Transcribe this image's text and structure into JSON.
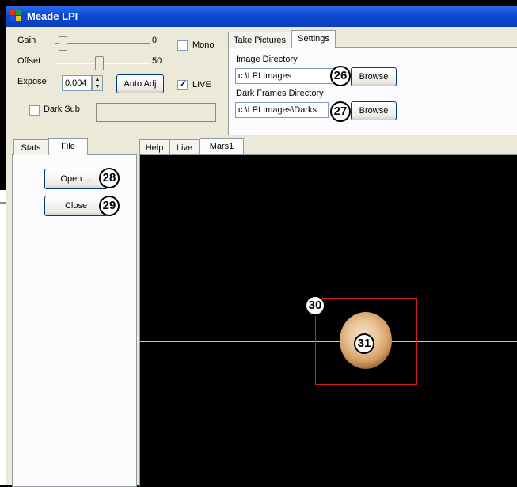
{
  "window": {
    "title": "Meade LPI"
  },
  "controls": {
    "gain": {
      "label": "Gain",
      "value": "0",
      "fraction": 0.0
    },
    "offset": {
      "label": "Offset",
      "value": "50",
      "fraction": 0.5
    },
    "expose": {
      "label": "Expose",
      "value": "0.004"
    },
    "auto_adj_label": "Auto Adj",
    "mono": {
      "label": "Mono",
      "checked": false
    },
    "live": {
      "label": "LIVE",
      "checked": true
    },
    "dark_sub": {
      "label": "Dark Sub",
      "checked": false
    }
  },
  "top_tabs": [
    {
      "label": "Take Pictures"
    },
    {
      "label": "Settings"
    }
  ],
  "settings": {
    "image_dir_label": "Image Directory",
    "image_dir_value": "c:\\LPI Images",
    "dark_dir_label": "Dark Frames Directory",
    "dark_dir_value": "c:\\LPI Images\\Darks",
    "browse_label": "Browse"
  },
  "left_tabs": [
    {
      "label": "Stats"
    },
    {
      "label": "File"
    }
  ],
  "file_panel": {
    "open_label": "Open ...",
    "close_label": "Close"
  },
  "view_tabs": [
    {
      "label": "Help"
    },
    {
      "label": "Live"
    },
    {
      "label": "Mars1"
    }
  ],
  "callouts": [
    "26",
    "27",
    "28",
    "29",
    "30",
    "31"
  ],
  "colors": {
    "crosshair": "#b8e070",
    "box": "#d02020",
    "titlebar": "#0a49d0"
  }
}
